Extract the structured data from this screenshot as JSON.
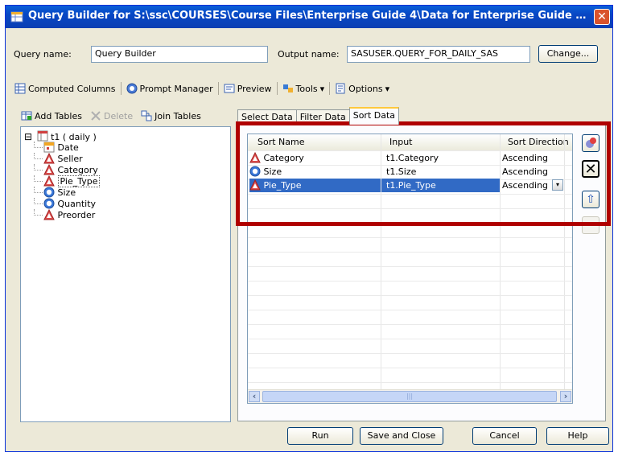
{
  "window": {
    "title": "Query Builder for S:\\ssc\\COURSES\\Course Files\\Enterprise Guide 4\\Data for Enterprise Guide Cl...",
    "close_glyph": "✕"
  },
  "form": {
    "query_name_label": "Query name:",
    "query_name_value": "Query Builder",
    "output_name_label": "Output name:",
    "output_name_value": "SASUSER.QUERY_FOR_DAILY_SAS",
    "change_label": "Change..."
  },
  "toolbar": {
    "computed_columns": "Computed Columns",
    "prompt_manager": "Prompt Manager",
    "preview": "Preview",
    "tools": "Tools",
    "options": "Options",
    "dropdown_glyph": "▾"
  },
  "left_toolbar": {
    "add_tables": "Add Tables",
    "delete": "Delete",
    "join_tables": "Join Tables"
  },
  "tree": {
    "expander": "⊟",
    "root": "t1 ( daily )",
    "columns": [
      {
        "label": "Date",
        "kind": "date"
      },
      {
        "label": "Seller",
        "kind": "char"
      },
      {
        "label": "Category",
        "kind": "char"
      },
      {
        "label": "Pie_Type",
        "kind": "char",
        "selected": true
      },
      {
        "label": "Size",
        "kind": "num"
      },
      {
        "label": "Quantity",
        "kind": "num"
      },
      {
        "label": "Preorder",
        "kind": "char"
      }
    ]
  },
  "tabs": [
    {
      "label": "Select Data",
      "active": false
    },
    {
      "label": "Filter Data",
      "active": false
    },
    {
      "label": "Sort Data",
      "active": true
    }
  ],
  "sort_grid": {
    "headers": [
      "Sort Name",
      "Input",
      "Sort Direction"
    ],
    "rows": [
      {
        "name": "Category",
        "input": "t1.Category",
        "direction": "Ascending",
        "kind": "char"
      },
      {
        "name": "Size",
        "input": "t1.Size",
        "direction": "Ascending",
        "kind": "num"
      },
      {
        "name": "Pie_Type",
        "input": "t1.Pie_Type",
        "direction": "Ascending",
        "kind": "char",
        "selected": true
      }
    ]
  },
  "side_buttons": {
    "remove_glyph": "✕",
    "up_glyph": "⇧"
  },
  "scroll": {
    "left_glyph": "‹",
    "right_glyph": "›",
    "thumb_grip": "|||"
  },
  "buttons": {
    "run": "Run",
    "save_close": "Save and Close",
    "cancel": "Cancel",
    "help": "Help"
  },
  "colors": {
    "title_blue": "#0b47c4",
    "highlight_red": "#b00000",
    "selection_blue": "#316ac5"
  }
}
